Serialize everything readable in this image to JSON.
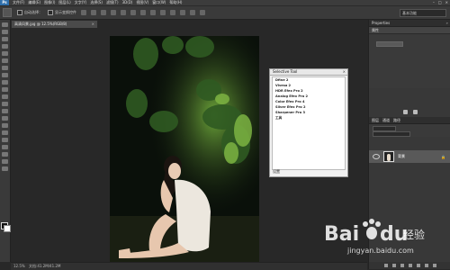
{
  "app": {
    "logo": "Ps",
    "menus": [
      "文件(F)",
      "编辑(E)",
      "图像(I)",
      "图层(L)",
      "文字(Y)",
      "选择(S)",
      "滤镜(T)",
      "3D(D)",
      "视图(V)",
      "窗口(W)",
      "帮助(H)"
    ],
    "window_controls": [
      "–",
      "□",
      "×"
    ]
  },
  "options": {
    "auto_select_label": "自动选择：",
    "transform_label": "显示变换控件",
    "workspace_value": "基本功能"
  },
  "document": {
    "tab_title": "高清风景.jpg @ 12.5%(RGB/8)",
    "tab_close": "×",
    "status_zoom": "12.5%",
    "status_doc": "文档:41.2M/41.2M"
  },
  "filter_window": {
    "title": "Selective Tool",
    "close": "×",
    "items": [
      "Dfine 2",
      "Vivesa 2",
      "HDR Efex Pro 2",
      "Analog Efex Pro 2",
      "Color Efex Pro 4",
      "Silver Efex Pro 2",
      "Sharpener Pro 3",
      "工具"
    ],
    "footer": "设置"
  },
  "right_panels": {
    "properties_title": "Properties",
    "properties_collapse": "»",
    "properties_tab": "属性",
    "layers_tabs": [
      "图层",
      "通道",
      "路径"
    ],
    "layer_name": "背景",
    "layer_lock": "🔒"
  },
  "watermark": {
    "text_bai": "Bai",
    "text_du": "du",
    "text_jingyan": "经验",
    "url": "jingyan.baidu.com"
  }
}
